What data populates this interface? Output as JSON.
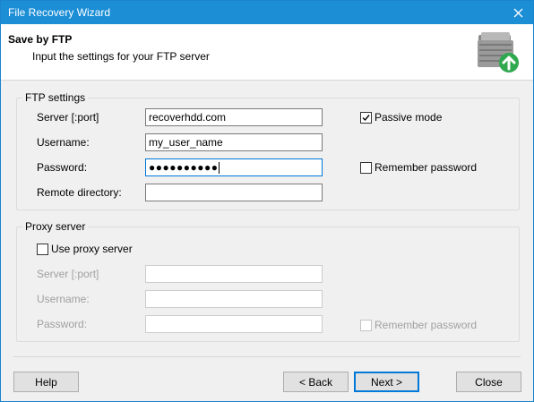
{
  "window": {
    "title": "File Recovery Wizard",
    "close_glyph": "✕"
  },
  "header": {
    "title": "Save by FTP",
    "subtitle": "Input the settings for your FTP server",
    "icon": "ftp-folder-icon"
  },
  "ftp": {
    "legend": "FTP settings",
    "server_label": "Server [:port]",
    "server_value": "recoverhdd.com",
    "username_label": "Username:",
    "username_value": "my_user_name",
    "password_label": "Password:",
    "password_masked": "●●●●●●●●●●",
    "remote_dir_label": "Remote directory:",
    "remote_dir_value": "",
    "passive_label": "Passive mode",
    "passive_checked": true,
    "remember_label": "Remember password",
    "remember_checked": false
  },
  "proxy": {
    "legend": "Proxy server",
    "use_label": "Use proxy server",
    "use_checked": false,
    "server_label": "Server [:port]",
    "server_value": "",
    "username_label": "Username:",
    "username_value": "",
    "password_label": "Password:",
    "password_value": "",
    "remember_label": "Remember password",
    "remember_checked": false
  },
  "buttons": {
    "help": "Help",
    "back": "< Back",
    "next": "Next >",
    "close": "Close"
  },
  "colors": {
    "titlebar": "#1b8ed6",
    "focus": "#0078d7",
    "icon_arrow": "#2fa84f"
  }
}
